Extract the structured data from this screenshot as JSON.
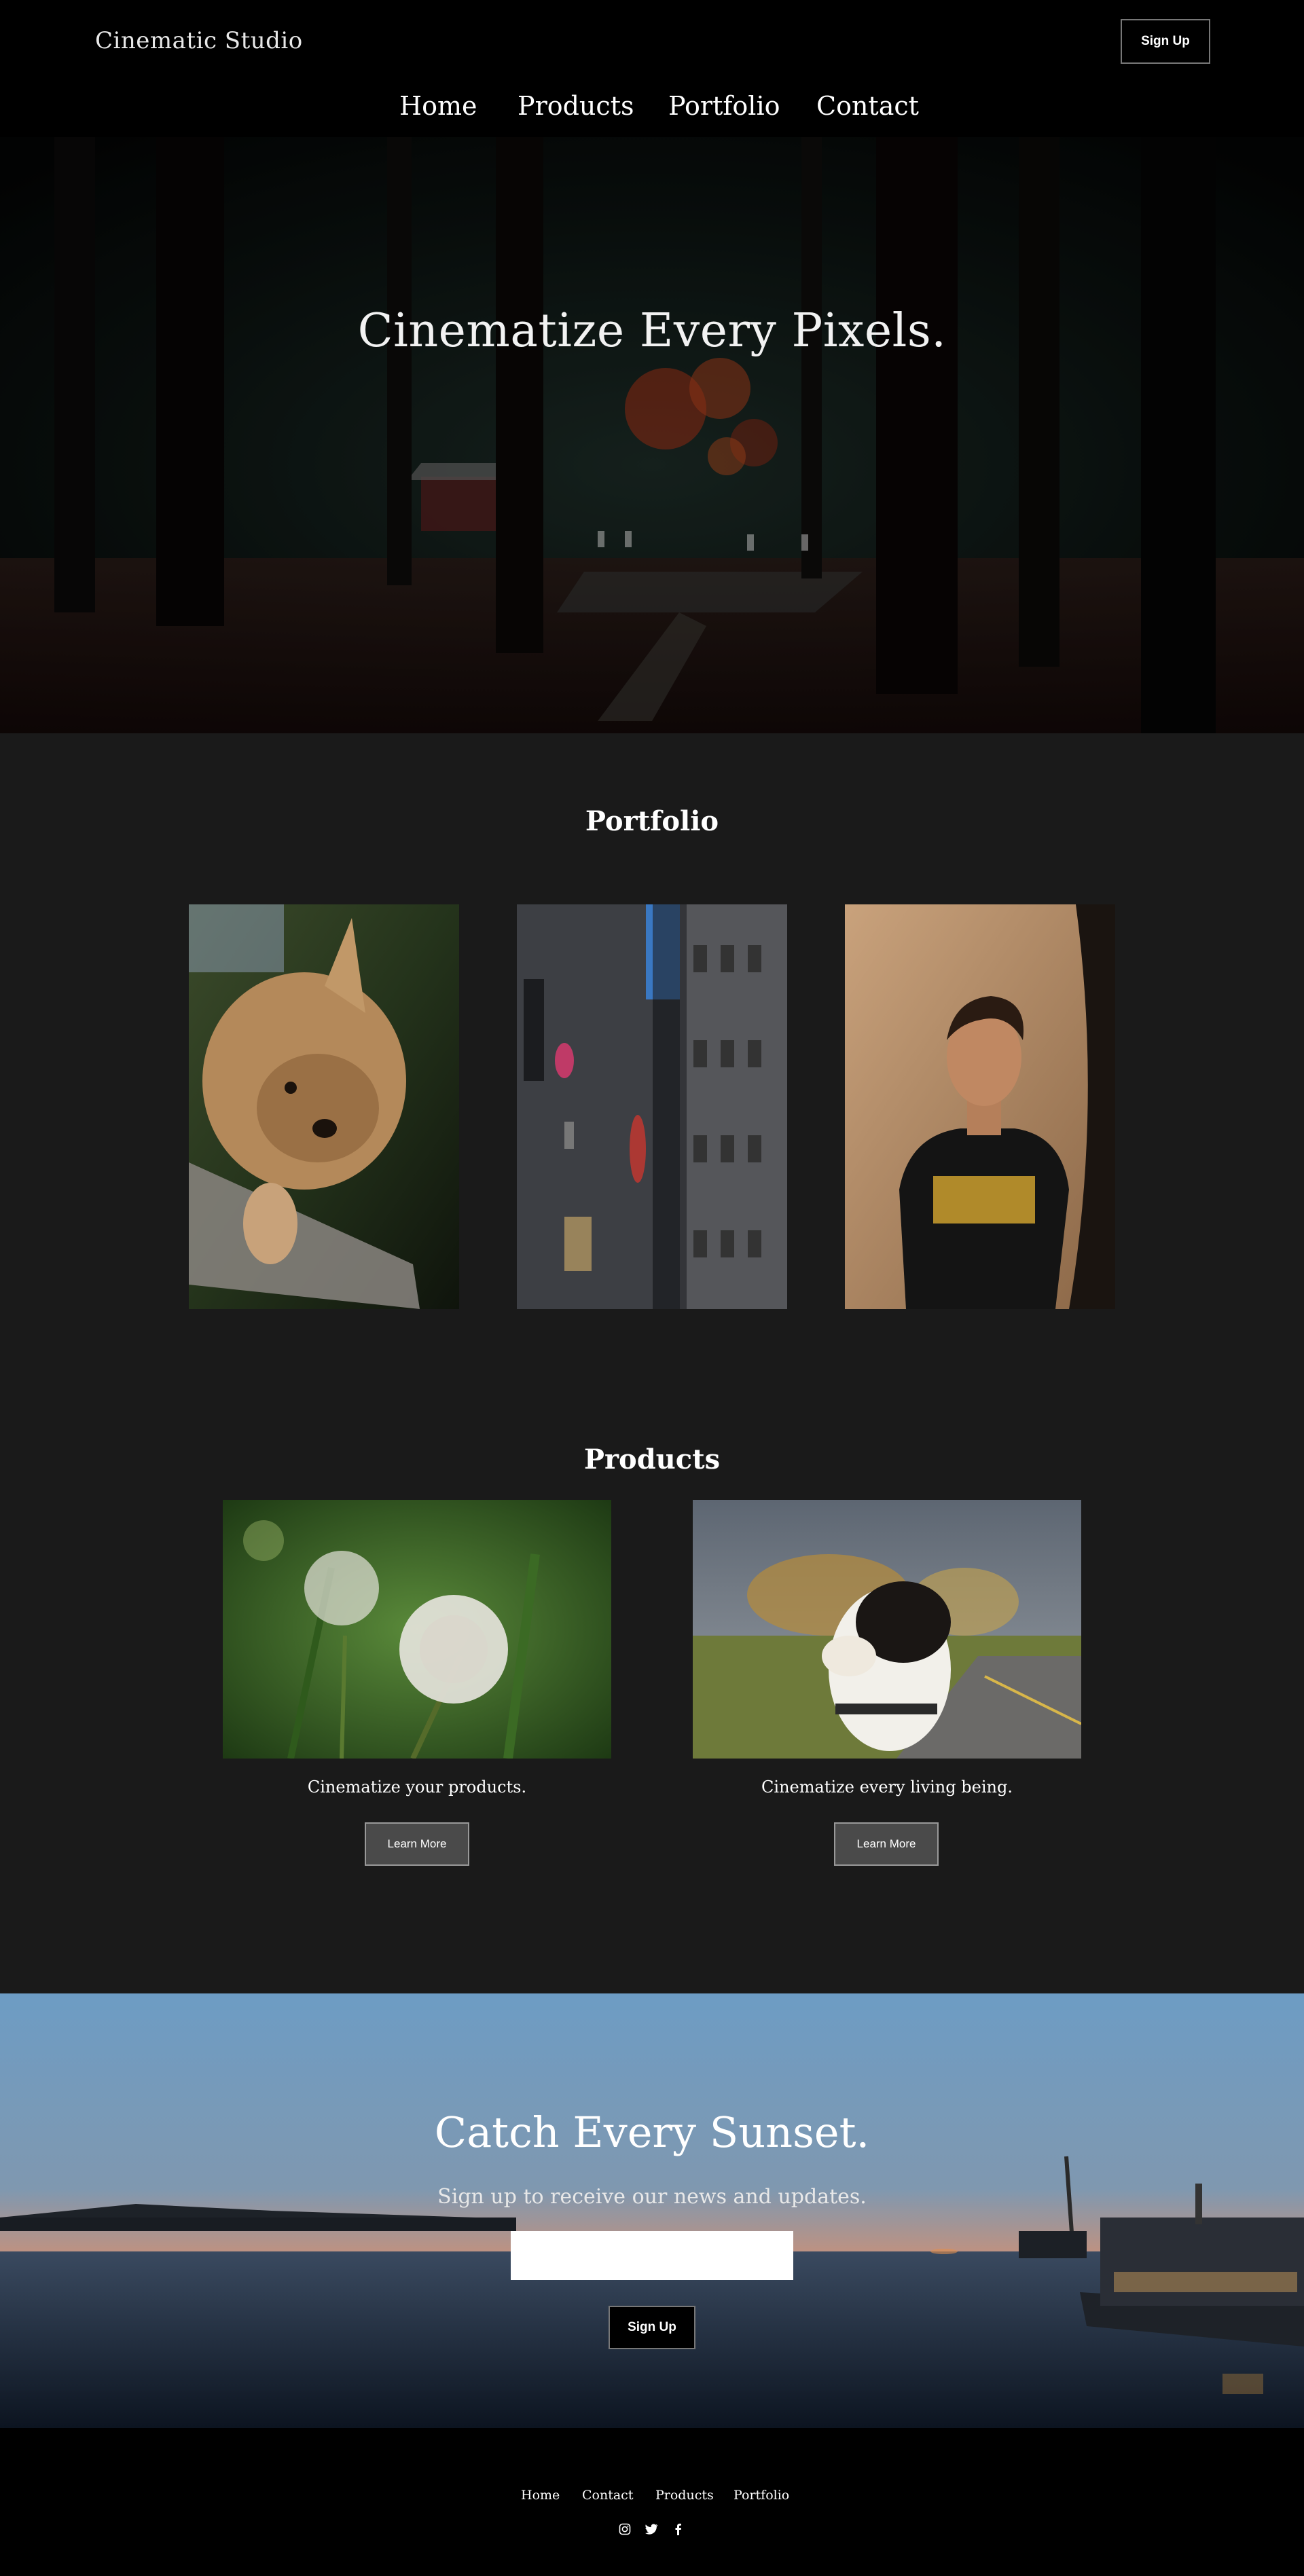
{
  "header": {
    "logo": "Cinematic Studio",
    "signup_label": "Sign Up"
  },
  "nav": {
    "items": [
      {
        "label": "Home"
      },
      {
        "label": "Products"
      },
      {
        "label": "Portfolio"
      },
      {
        "label": "Contact"
      }
    ]
  },
  "hero": {
    "title": "Cinematize Every Pixels."
  },
  "portfolio": {
    "title": "Portfolio",
    "photos": [
      {
        "subject": "yorkshire-terrier"
      },
      {
        "subject": "city-street-buildings"
      },
      {
        "subject": "man-portrait"
      }
    ]
  },
  "products": {
    "title": "Products",
    "items": [
      {
        "subject": "dandelion",
        "caption": "Cinematize your products.",
        "button": "Learn More"
      },
      {
        "subject": "dog-portrait",
        "caption": "Cinematize every living being.",
        "button": "Learn More"
      }
    ]
  },
  "sunset": {
    "title": "Catch Every Sunset.",
    "subtitle": "Sign up to receive our news and updates.",
    "email_value": "",
    "signup_label": "Sign Up"
  },
  "footer": {
    "links": [
      {
        "label": "Home"
      },
      {
        "label": "Contact"
      },
      {
        "label": "Products"
      },
      {
        "label": "Portfolio"
      }
    ],
    "social": [
      "instagram-icon",
      "twitter-icon",
      "facebook-icon"
    ]
  },
  "colors": {
    "page_bg": "#000000",
    "section_bg": "#1a1a1a",
    "button_bg": "#4a4a4a",
    "text": "#ffffff"
  }
}
